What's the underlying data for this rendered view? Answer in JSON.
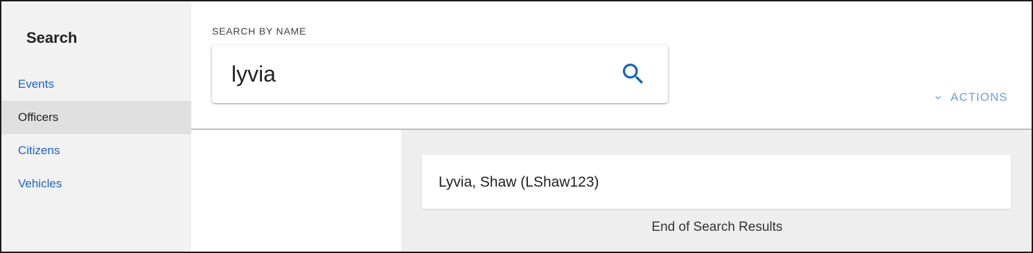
{
  "sidebar": {
    "title": "Search",
    "items": [
      {
        "label": "Events"
      },
      {
        "label": "Officers"
      },
      {
        "label": "Citizens"
      },
      {
        "label": "Vehicles"
      }
    ],
    "active_item": "Officers"
  },
  "search": {
    "label": "SEARCH BY NAME",
    "value": "lyvia",
    "icon": "search-icon"
  },
  "toolbar": {
    "actions_label": "ACTIONS",
    "actions_icon": "chevron-down-icon"
  },
  "results": {
    "items": [
      {
        "text": "Lyvia, Shaw (LShaw123)"
      }
    ],
    "end_text": "End of Search Results"
  },
  "colors": {
    "link": "#1a63c6",
    "accent": "#1565c0",
    "actions": "#6b9fd9",
    "sidebar_bg": "#f2f2f2",
    "active_bg": "#e0e0e0"
  }
}
